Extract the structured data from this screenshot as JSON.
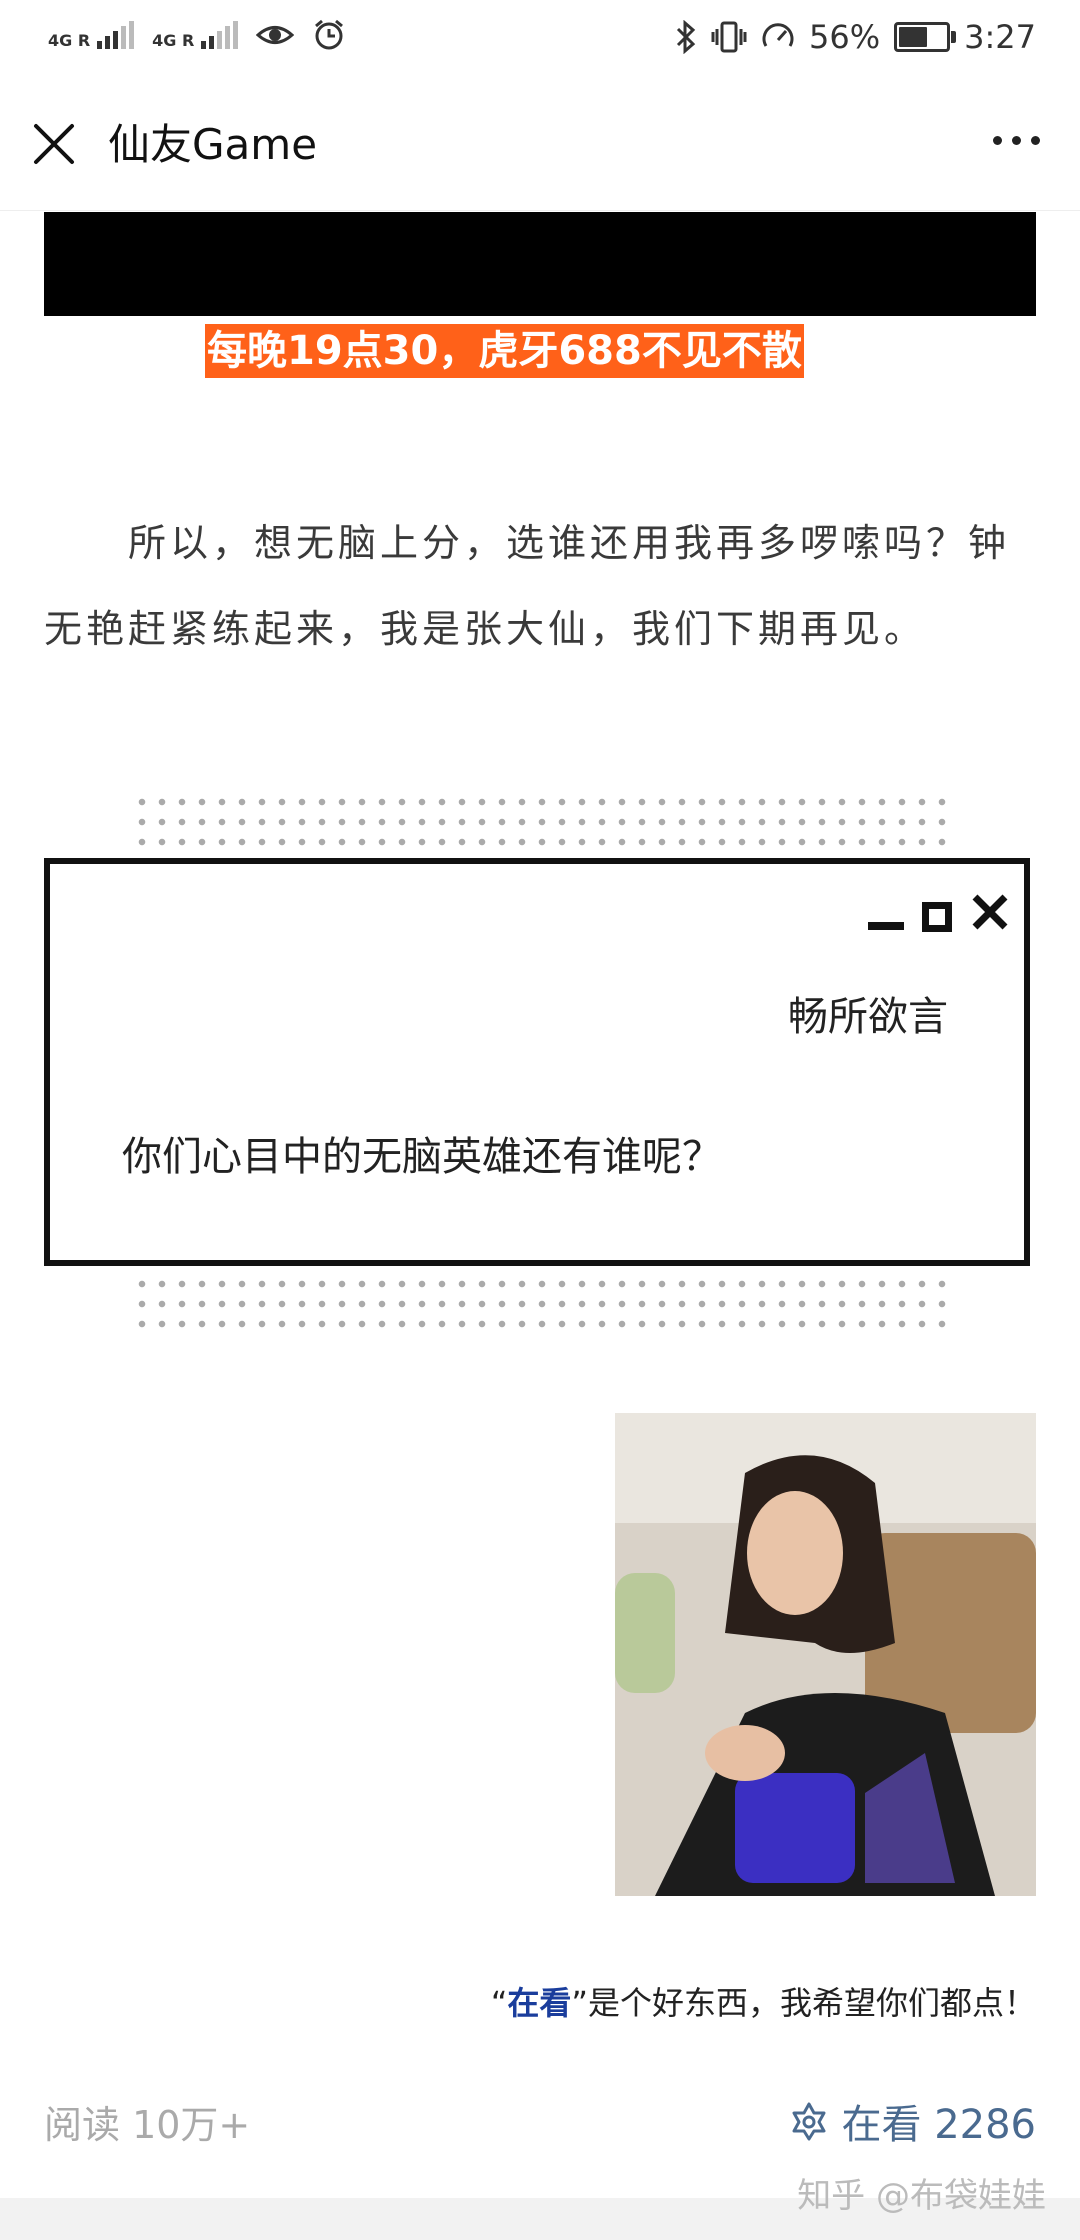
{
  "status_bar": {
    "sim1_label": "4G R",
    "sim2_label": "4G R",
    "battery_percent": "56%",
    "battery_level": 0.56,
    "time": "3:27"
  },
  "header": {
    "title": "仙友Game",
    "close_icon": "close-icon",
    "more_icon": "more-icon"
  },
  "article": {
    "banner": "每晚19点30，虎牙688不见不散",
    "paragraph": "　　所以，想无脑上分，选谁还用我再多啰嗦吗？钟无艳赶紧练起来，我是张大仙，我们下期再见。",
    "comment_box": {
      "label": "畅所欲言",
      "question": "你们心目中的无脑英雄还有谁呢？"
    },
    "tagline_prefix": "“",
    "tagline_highlight": "在看",
    "tagline_rest": "”是个好东西，我希望你们都点！"
  },
  "footer": {
    "reads": "阅读 10万+",
    "zaikan": "在看 2286"
  },
  "watermark": "知乎 @布袋娃娃",
  "colors": {
    "banner_bg": "#ff6119",
    "highlight": "#1a3d9c",
    "zaikan": "#4a6a8f"
  }
}
